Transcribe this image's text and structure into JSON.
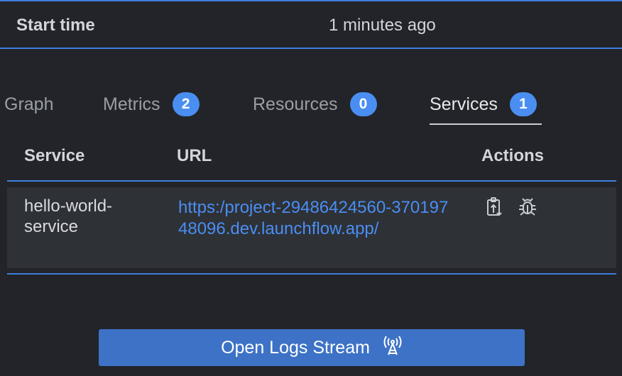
{
  "details": {
    "start_time_label": "Start time",
    "start_time_value": "1 minutes ago"
  },
  "tabs": [
    {
      "label": "Graph",
      "count": null,
      "active": false
    },
    {
      "label": "Metrics",
      "count": "2",
      "active": false
    },
    {
      "label": "Resources",
      "count": "0",
      "active": false
    },
    {
      "label": "Services",
      "count": "1",
      "active": true
    }
  ],
  "services_table": {
    "columns": [
      "Service",
      "URL",
      "Actions"
    ],
    "rows": [
      {
        "service": "hello-world-service",
        "url": "https:/project-29486424560-37019748096.dev.launchflow.app/",
        "actions": [
          "clipboard-upload-icon",
          "bug-icon"
        ]
      }
    ]
  },
  "logs_button": {
    "label": "Open Logs Stream",
    "icon": "broadcast-tower-icon"
  },
  "colors": {
    "accent": "#4a8ef2",
    "border": "#3f7fdc",
    "background": "#222429",
    "row_background": "#2e3136",
    "button": "#3d72c6"
  }
}
